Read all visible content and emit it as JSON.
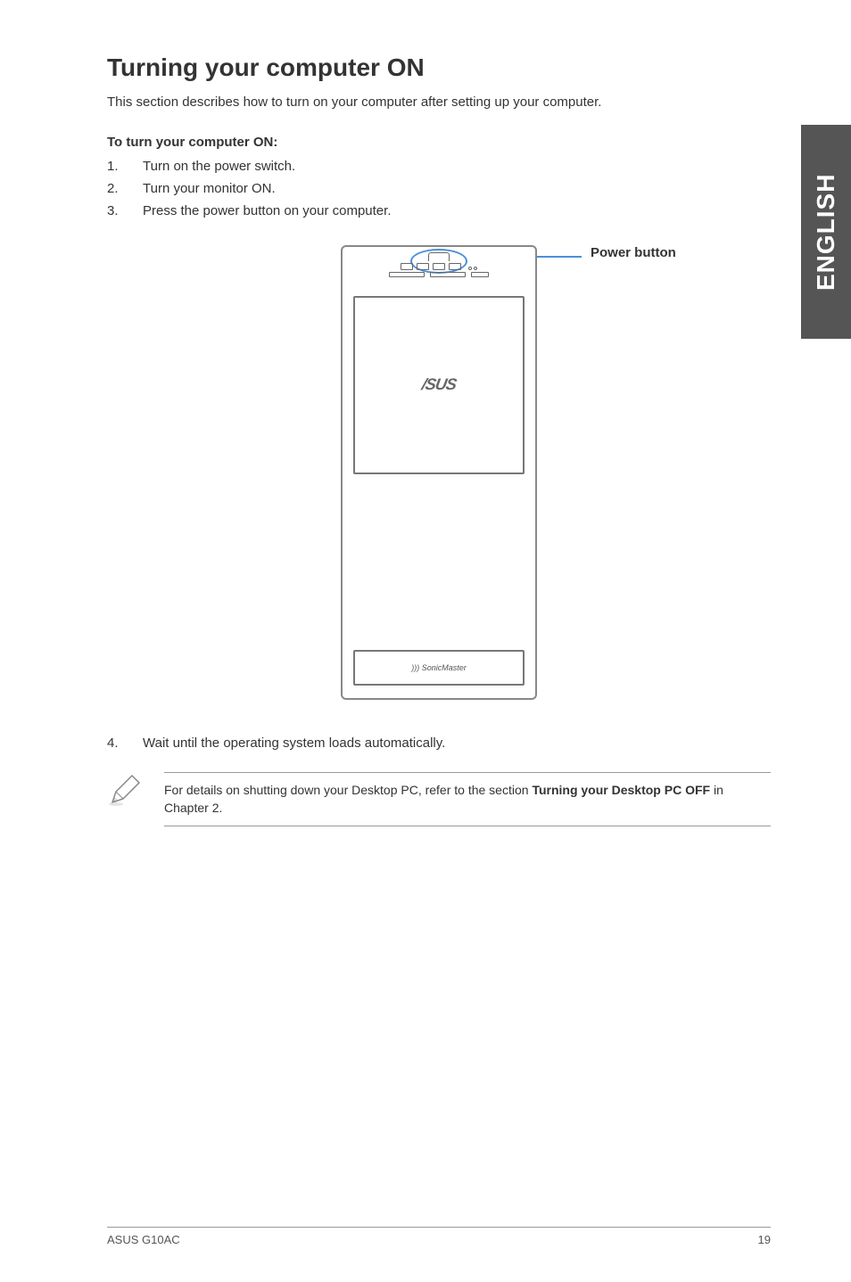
{
  "sideTab": "ENGLISH",
  "heading": "Turning your computer ON",
  "intro": "This section describes how to turn on your computer after setting up your computer.",
  "subhead": "To turn your computer ON:",
  "steps": [
    {
      "num": "1.",
      "text": "Turn on the power switch."
    },
    {
      "num": "2.",
      "text": "Turn your monitor ON."
    },
    {
      "num": "3.",
      "text": "Press the power button on your computer."
    }
  ],
  "diagram": {
    "calloutLabel": "Power button",
    "logo": "/SUS",
    "logoSub": "",
    "sonic": "SonicMaster"
  },
  "step4": {
    "num": "4.",
    "text": "Wait until the operating system loads automatically."
  },
  "note": {
    "prefix": "For details on shutting down your Desktop PC, refer to the section ",
    "bold": "Turning your Desktop PC OFF",
    "suffix": " in Chapter 2."
  },
  "footer": {
    "left": "ASUS G10AC",
    "right": "19"
  }
}
